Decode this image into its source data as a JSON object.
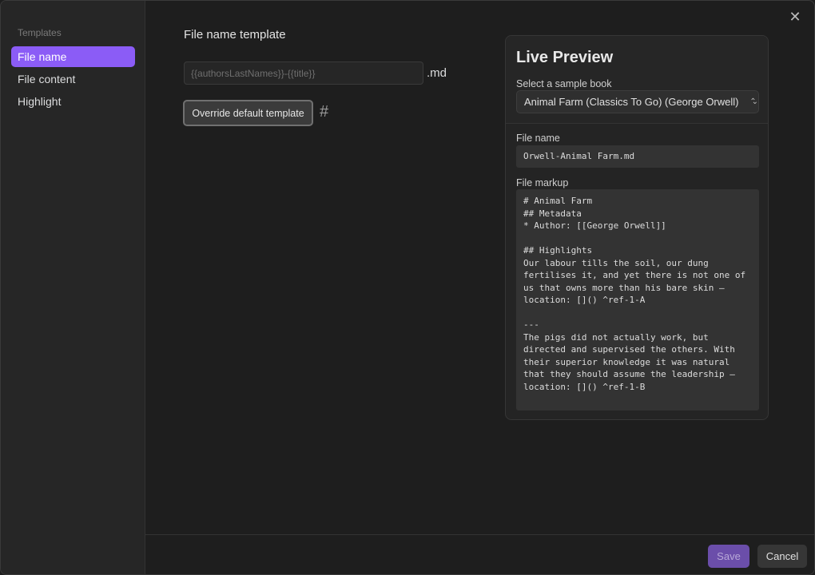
{
  "sidebar": {
    "heading": "Templates",
    "items": [
      {
        "label": "File name",
        "active": true
      },
      {
        "label": "File content",
        "active": false
      },
      {
        "label": "Highlight",
        "active": false
      }
    ]
  },
  "close_icon": "close-icon",
  "main": {
    "section_title": "File name template",
    "template_placeholder": "{{authorsLastNames}}-{{title}}",
    "template_value": "",
    "extension": ".md",
    "override_button": "Override default template",
    "hash_icon": "#"
  },
  "preview": {
    "title": "Live Preview",
    "sample_label": "Select a sample book",
    "sample_selected": "Animal Farm (Classics To Go) (George Orwell)",
    "file_name_label": "File name",
    "file_name_value": "Orwell-Animal Farm.md",
    "file_markup_label": "File markup",
    "file_markup_value": "# Animal Farm\n## Metadata\n* Author: [[George Orwell]]\n\n## Highlights\nOur labour tills the soil, our dung fertilises it, and yet there is not one of us that owns more than his bare skin — location: []() ^ref-1-A\n\n---\nThe pigs did not actually work, but directed and supervised the others. With their superior knowledge it was natural that they should assume the leadership — location: []() ^ref-1-B\n\n---"
  },
  "footer": {
    "save": "Save",
    "cancel": "Cancel"
  },
  "colors": {
    "accent": "#8b5cf6",
    "save_disabled": "#6b4eaa"
  }
}
